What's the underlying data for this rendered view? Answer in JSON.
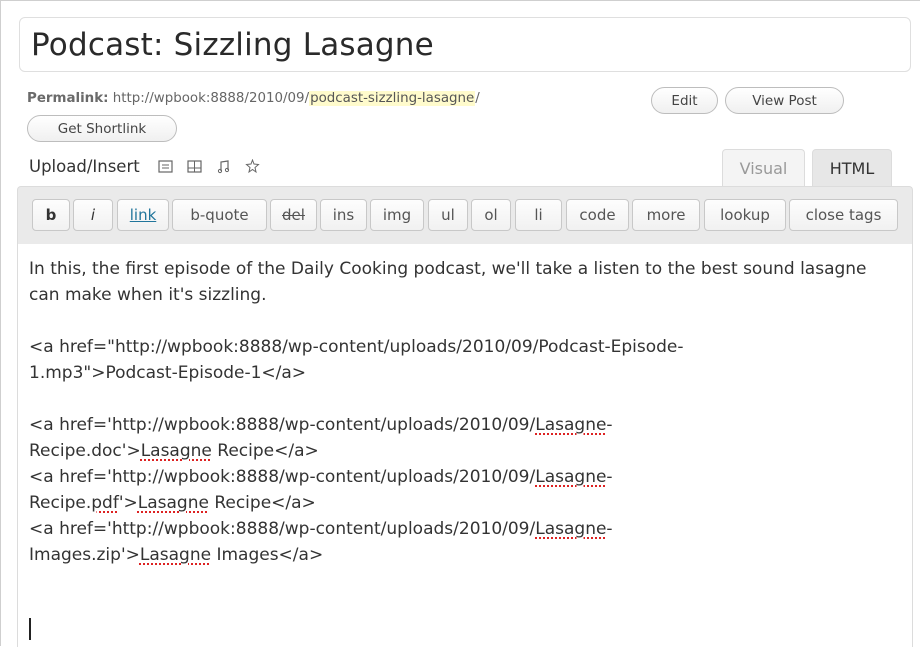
{
  "post": {
    "title": "Podcast: Sizzling Lasagne"
  },
  "permalink": {
    "label": "Permalink:",
    "url_prefix": "http://wpbook:8888/2010/09/",
    "slug": "podcast-sizzling-lasagne",
    "url_suffix": "/",
    "edit_label": "Edit",
    "view_post_label": "View Post",
    "shortlink_label": "Get Shortlink"
  },
  "media": {
    "label": "Upload/Insert",
    "icons": [
      "image-icon",
      "video-icon",
      "audio-icon",
      "media-icon"
    ]
  },
  "tabs": {
    "visual": "Visual",
    "html": "HTML",
    "active": "HTML"
  },
  "toolbar": {
    "buttons": [
      "b",
      "i",
      "link",
      "b-quote",
      "del",
      "ins",
      "img",
      "ul",
      "ol",
      "li",
      "code",
      "more",
      "lookup",
      "close tags"
    ]
  },
  "content": {
    "para1": "In this, the first episode of the Daily Cooking podcast, we'll take a listen to the best sound lasagne can make when it's sizzling.",
    "line2a": "<a href=\"http://wpbook:8888/wp-content/uploads/2010/09/Podcast-Episode-",
    "line2b": "1.mp3\">Podcast-Episode-1</a>",
    "line3a_prefix": "<a href='http://wpbook:8888/wp-content/uploads/2010/09/",
    "line3a_word": "Lasagne",
    "line3a_suffix": "-",
    "line3b_prefix": "Recipe.doc'>",
    "line3b_word": "Lasagne",
    "line3b_suffix": " Recipe</a>",
    "line4a_prefix": "<a href='http://wpbook:8888/wp-content/uploads/2010/09/",
    "line4a_word": "Lasagne",
    "line4a_suffix": "-",
    "line4b_prefix": "Recipe.",
    "line4b_word1": "pdf",
    "line4b_mid": "'>",
    "line4b_word2": "Lasagne",
    "line4b_suffix": " Recipe</a>",
    "line5a_prefix": "<a href='http://wpbook:8888/wp-content/uploads/2010/09/",
    "line5a_word": "Lasagne",
    "line5a_suffix": "-",
    "line5b_prefix": "Images.zip'>",
    "line5b_word": "Lasagne",
    "line5b_suffix": " Images</a>"
  },
  "colors": {
    "slug_highlight": "#fffbcc",
    "link_blue": "#21759b",
    "spellcheck_red": "#d22"
  }
}
